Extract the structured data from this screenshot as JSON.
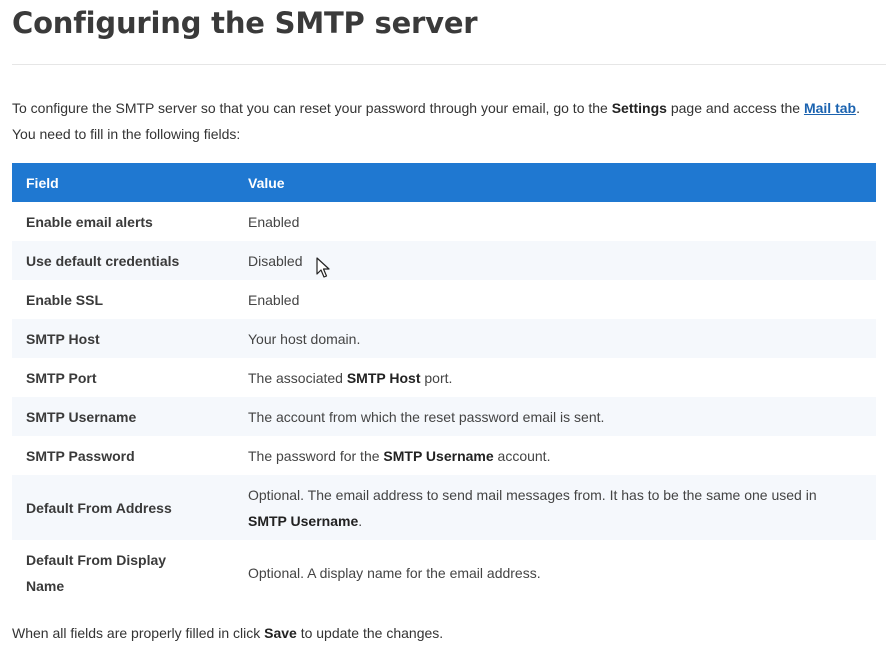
{
  "heading": "Configuring the SMTP server",
  "intro": {
    "p1": "To configure the SMTP server so that you can reset your password through your email, go to the ",
    "settings": "Settings",
    "p2": " page and access the ",
    "mail_link": "Mail tab",
    "p3": ". You need to fill in the following fields:"
  },
  "table": {
    "headers": {
      "field": "Field",
      "value": "Value"
    },
    "rows": [
      {
        "field": "Enable email alerts",
        "value_pre": "Enabled",
        "value_bold": "",
        "value_post": ""
      },
      {
        "field": "Use default credentials",
        "value_pre": "Disabled",
        "value_bold": "",
        "value_post": ""
      },
      {
        "field": "Enable SSL",
        "value_pre": "Enabled",
        "value_bold": "",
        "value_post": ""
      },
      {
        "field": "SMTP Host",
        "value_pre": "Your host domain.",
        "value_bold": "",
        "value_post": ""
      },
      {
        "field": "SMTP Port",
        "value_pre": "The associated ",
        "value_bold": "SMTP Host",
        "value_post": " port."
      },
      {
        "field": "SMTP Username",
        "value_pre": "The account from which the reset password email is sent.",
        "value_bold": "",
        "value_post": ""
      },
      {
        "field": "SMTP Password",
        "value_pre": "The password for the ",
        "value_bold": "SMTP Username",
        "value_post": " account."
      },
      {
        "field": "Default From Address",
        "value_pre": "Optional. The email address to send mail messages from. It has to be the same one used in ",
        "value_bold": "SMTP Username",
        "value_post": "."
      },
      {
        "field": "Default From Display Name",
        "value_pre": "Optional. A display name for the email address.",
        "value_bold": "",
        "value_post": ""
      }
    ]
  },
  "footer": {
    "p1": "When all fields are properly filled in click ",
    "save": "Save",
    "p2": " to update the changes."
  },
  "colors": {
    "header_bg": "#1f78d1",
    "stripe": "#f5f8fc",
    "link": "#1b63b0"
  },
  "icons": {
    "cursor": "mouse-pointer-icon"
  }
}
